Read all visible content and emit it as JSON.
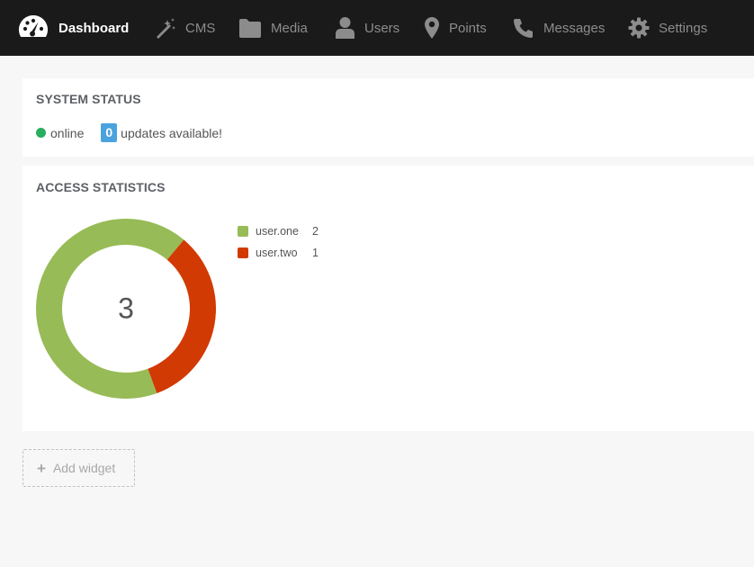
{
  "nav": {
    "items": [
      {
        "label": "Dashboard",
        "icon": "dashboard-icon"
      },
      {
        "label": "CMS",
        "icon": "magic-wand-icon"
      },
      {
        "label": "Media",
        "icon": "folder-icon"
      },
      {
        "label": "Users",
        "icon": "user-icon"
      },
      {
        "label": "Points",
        "icon": "map-marker-icon"
      },
      {
        "label": "Messages",
        "icon": "phone-icon"
      },
      {
        "label": "Settings",
        "icon": "gear-icon"
      }
    ],
    "active": "Dashboard"
  },
  "system_status": {
    "title": "SYSTEM STATUS",
    "status_text": "online",
    "status_color": "#27ae60",
    "updates_count": "0",
    "updates_text": "updates available!"
  },
  "access_statistics": {
    "title": "ACCESS STATISTICS",
    "total": "3",
    "chart_data": {
      "type": "pie",
      "categories": [
        "user.one",
        "user.two"
      ],
      "values": [
        2,
        1
      ],
      "colors": [
        "#97bb56",
        "#d23a03"
      ]
    },
    "legend": [
      {
        "name": "user.one",
        "value": "2"
      },
      {
        "name": "user.two",
        "value": "1"
      }
    ]
  },
  "add_widget": {
    "icon": "plus-icon",
    "label": "Add widget"
  }
}
